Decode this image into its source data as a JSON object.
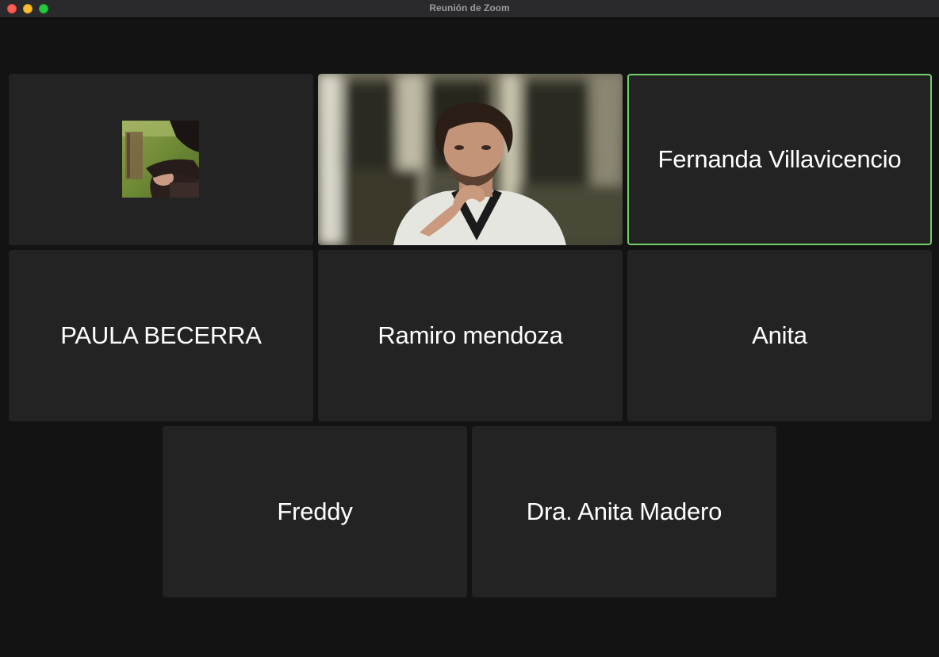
{
  "window": {
    "title": "Reunión de Zoom"
  },
  "participants": [
    {
      "name": "",
      "has_profile_photo": true,
      "has_video": false,
      "active_speaker": false
    },
    {
      "name": "",
      "has_profile_photo": false,
      "has_video": true,
      "active_speaker": false
    },
    {
      "name": "Fernanda Villavicencio",
      "has_video": false,
      "active_speaker": true
    },
    {
      "name": "PAULA BECERRA",
      "has_video": false,
      "active_speaker": false
    },
    {
      "name": "Ramiro mendoza",
      "has_video": false,
      "active_speaker": false
    },
    {
      "name": "Anita",
      "has_video": false,
      "active_speaker": false
    },
    {
      "name": "Freddy",
      "has_video": false,
      "active_speaker": false
    },
    {
      "name": "Dra. Anita Madero",
      "has_video": false,
      "active_speaker": false
    }
  ],
  "colors": {
    "background": "#131313",
    "tile": "#232323",
    "active_speaker_border": "#6fd06a",
    "name_text": "#ffffff"
  }
}
